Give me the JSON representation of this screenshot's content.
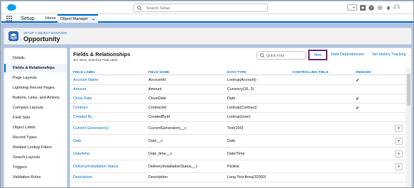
{
  "header": {
    "search_placeholder": "Search Setup"
  },
  "nav": {
    "app_name": "Setup",
    "tabs": [
      {
        "label": "Home"
      },
      {
        "label": "Object Manager"
      }
    ]
  },
  "page": {
    "breadcrumb": [
      "SETUP",
      "OBJECT MANAGER"
    ],
    "breadcrumb_sep": " > ",
    "title": "Opportunity"
  },
  "sidebar": {
    "items": [
      {
        "label": "Details"
      },
      {
        "label": "Fields & Relationships"
      },
      {
        "label": "Page Layouts"
      },
      {
        "label": "Lightning Record Pages"
      },
      {
        "label": "Buttons, Links, and Actions"
      },
      {
        "label": "Compact Layouts"
      },
      {
        "label": "Field Sets"
      },
      {
        "label": "Object Limits"
      },
      {
        "label": "Record Types"
      },
      {
        "label": "Related Lookup Filters"
      },
      {
        "label": "Search Layouts"
      },
      {
        "label": "Triggers"
      },
      {
        "label": "Validation Rules"
      }
    ],
    "active_index": 1
  },
  "main": {
    "title": "Fields & Relationships",
    "subtitle": "30+ Items, Sorted by Field Label",
    "quick_find_placeholder": "Quick Find",
    "new_button": "New",
    "field_dependencies": "Field Dependencies",
    "set_history_tracking": "Set History Tracking",
    "columns": [
      "FIELD LABEL",
      "FIELD NAME",
      "DATA TYPE",
      "CONTROLLING FIELD",
      "INDEXED"
    ],
    "rows": [
      {
        "label": "Account Name",
        "name": "AccountId",
        "type": "Lookup(Account)",
        "indexed": true,
        "menu": false
      },
      {
        "label": "Amount",
        "name": "Amount",
        "type": "Currency(16, 2)",
        "indexed": false,
        "menu": false
      },
      {
        "label": "Close Date",
        "name": "CloseDate",
        "type": "Date",
        "indexed": true,
        "menu": false
      },
      {
        "label": "Contract",
        "name": "ContractId",
        "type": "Lookup(Contract)",
        "indexed": true,
        "menu": false
      },
      {
        "label": "Created By",
        "name": "CreatedById",
        "type": "Lookup(User)",
        "indexed": false,
        "menu": false
      },
      {
        "label": "Current Generator(s)",
        "name": "CurrentGenerators__c",
        "type": "Text(100)",
        "indexed": false,
        "menu": true
      },
      {
        "label": "Date",
        "name": "Date__c",
        "type": "Date",
        "indexed": false,
        "menu": true
      },
      {
        "label": "Date/time",
        "name": "Date_time__c",
        "type": "Date/Time",
        "indexed": false,
        "menu": true
      },
      {
        "label": "Delivery/Installation Status",
        "name": "DeliveryInstallationStatus__c",
        "type": "Picklist",
        "indexed": false,
        "menu": true
      },
      {
        "label": "Description",
        "name": "Description",
        "type": "Long Text Area(32000)",
        "indexed": false,
        "menu": false
      }
    ],
    "check_glyph": "✔",
    "menu_glyph": "▾"
  },
  "colors": {
    "brand": "#0070d2",
    "highlight_border": "#6a2b88",
    "page_bg": "#b0c4df"
  }
}
